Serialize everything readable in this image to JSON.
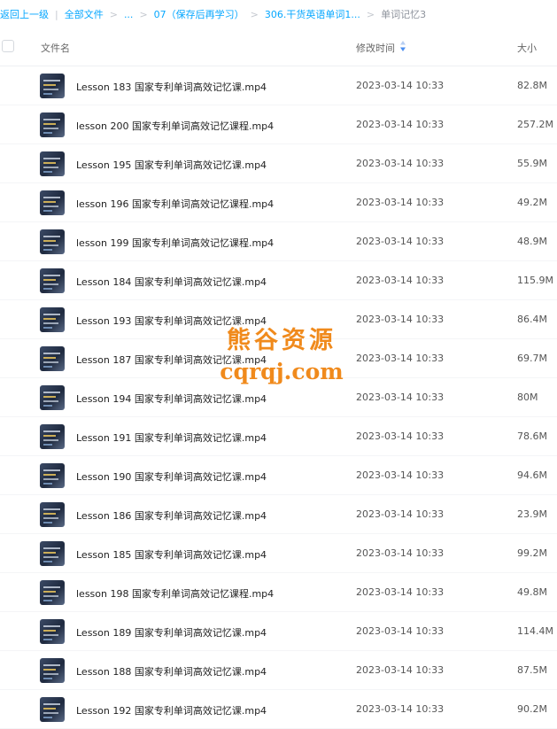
{
  "breadcrumb": {
    "back": "返回上一级",
    "sep": "|",
    "all_files": "全部文件",
    "chevron": ">",
    "ellipsis": "...",
    "folder1": "07（保存后再学习）",
    "folder2": "306.干货英语单词1...",
    "current": "单词记忆3"
  },
  "header": {
    "name": "文件名",
    "time": "修改时间",
    "size": "大小",
    "sort_icon": "sort-desc-icon"
  },
  "files": [
    {
      "name": "Lesson 183 国家专利单词高效记忆课.mp4",
      "time": "2023-03-14 10:33",
      "size": "82.8M"
    },
    {
      "name": "lesson 200 国家专利单词高效记忆课程.mp4",
      "time": "2023-03-14 10:33",
      "size": "257.2M"
    },
    {
      "name": "Lesson 195 国家专利单词高效记忆课.mp4",
      "time": "2023-03-14 10:33",
      "size": "55.9M"
    },
    {
      "name": "lesson 196 国家专利单词高效记忆课程.mp4",
      "time": "2023-03-14 10:33",
      "size": "49.2M"
    },
    {
      "name": "lesson 199 国家专利单词高效记忆课程.mp4",
      "time": "2023-03-14 10:33",
      "size": "48.9M"
    },
    {
      "name": "Lesson 184 国家专利单词高效记忆课.mp4",
      "time": "2023-03-14 10:33",
      "size": "115.9M"
    },
    {
      "name": "Lesson 193 国家专利单词高效记忆课.mp4",
      "time": "2023-03-14 10:33",
      "size": "86.4M"
    },
    {
      "name": "Lesson 187 国家专利单词高效记忆课.mp4",
      "time": "2023-03-14 10:33",
      "size": "69.7M"
    },
    {
      "name": "Lesson 194 国家专利单词高效记忆课.mp4",
      "time": "2023-03-14 10:33",
      "size": "80M"
    },
    {
      "name": "Lesson 191 国家专利单词高效记忆课.mp4",
      "time": "2023-03-14 10:33",
      "size": "78.6M"
    },
    {
      "name": "Lesson 190 国家专利单词高效记忆课.mp4",
      "time": "2023-03-14 10:33",
      "size": "94.6M"
    },
    {
      "name": "Lesson 186 国家专利单词高效记忆课.mp4",
      "time": "2023-03-14 10:33",
      "size": "23.9M"
    },
    {
      "name": "Lesson 185 国家专利单词高效记忆课.mp4",
      "time": "2023-03-14 10:33",
      "size": "99.2M"
    },
    {
      "name": "lesson 198 国家专利单词高效记忆课程.mp4",
      "time": "2023-03-14 10:33",
      "size": "49.8M"
    },
    {
      "name": "Lesson 189 国家专利单词高效记忆课.mp4",
      "time": "2023-03-14 10:33",
      "size": "114.4M"
    },
    {
      "name": "Lesson 188 国家专利单词高效记忆课.mp4",
      "time": "2023-03-14 10:33",
      "size": "87.5M"
    },
    {
      "name": "Lesson 192 国家专利单词高效记忆课.mp4",
      "time": "2023-03-14 10:33",
      "size": "90.2M"
    }
  ],
  "watermark": {
    "line1": "熊谷资源",
    "line2": "cqrqj.com"
  },
  "colors": {
    "link": "#06a7ff",
    "watermark": "#f08a1c"
  }
}
